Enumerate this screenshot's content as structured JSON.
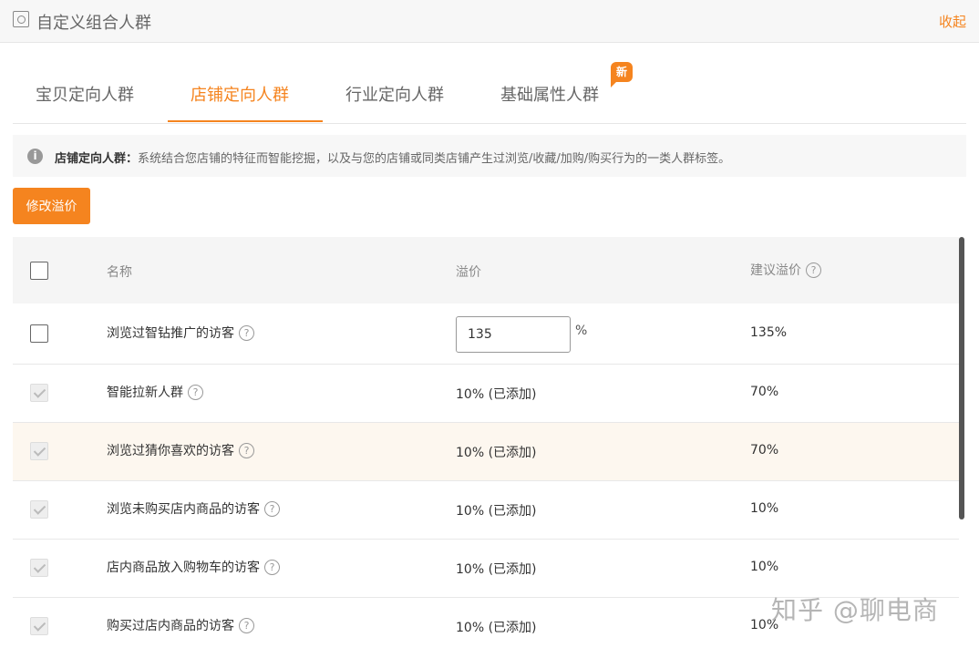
{
  "header": {
    "title": "自定义组合人群",
    "collapse_label": "收起"
  },
  "tabs": [
    {
      "label": "宝贝定向人群",
      "active": false
    },
    {
      "label": "店铺定向人群",
      "active": true
    },
    {
      "label": "行业定向人群",
      "active": false
    },
    {
      "label": "基础属性人群",
      "active": false,
      "badge": "新"
    }
  ],
  "info": {
    "label": "店铺定向人群：",
    "text": "系统结合您店铺的特征而智能挖掘，以及与您的店铺或同类店铺产生过浏览/收藏/加购/购买行为的一类人群标签。"
  },
  "modify_button": "修改溢价",
  "table": {
    "columns": [
      "名称",
      "溢价",
      "建议溢价"
    ],
    "rows": [
      {
        "name": "浏览过智钻推广的访客",
        "premium_value": "135",
        "premium_unit": "%",
        "suggested": "135%",
        "checked": false,
        "editable": true
      },
      {
        "name": "智能拉新人群",
        "premium": "10% (已添加)",
        "suggested": "70%",
        "checked": true
      },
      {
        "name": "浏览过猜你喜欢的访客",
        "premium": "10% (已添加)",
        "suggested": "70%",
        "checked": true
      },
      {
        "name": "浏览未购买店内商品的访客",
        "premium": "10% (已添加)",
        "suggested": "10%",
        "checked": true
      },
      {
        "name": "店内商品放入购物车的访客",
        "premium": "10% (已添加)",
        "suggested": "10%",
        "checked": true
      },
      {
        "name": "购买过店内商品的访客",
        "premium": "10% (已添加)",
        "suggested": "10%",
        "checked": true
      }
    ]
  },
  "watermark": "知乎 @聊电商",
  "colors": {
    "accent": "#f5841f",
    "hover_row": "#fdf7ef"
  }
}
